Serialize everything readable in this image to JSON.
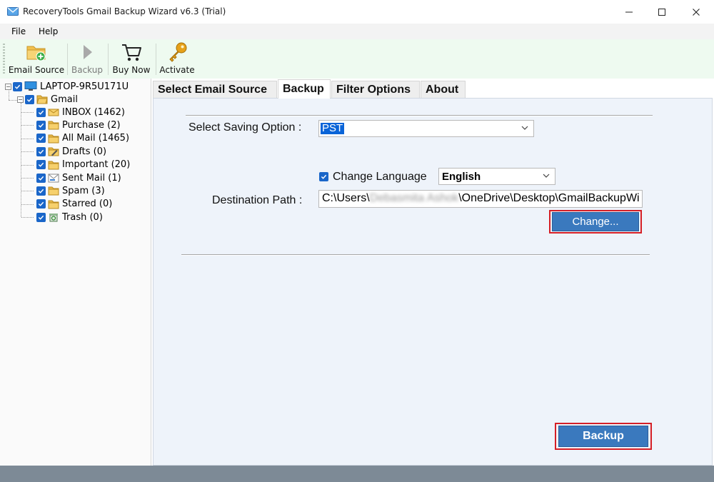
{
  "window": {
    "title": "RecoveryTools Gmail Backup Wizard v6.3 (Trial)",
    "minimize_glyph": "—",
    "maximize_glyph": "☐",
    "close_glyph": "✕"
  },
  "menu": {
    "items": [
      {
        "label": "File"
      },
      {
        "label": "Help"
      }
    ]
  },
  "toolbar": {
    "buttons": [
      {
        "label": "Email Source",
        "icon": "folder-add-icon",
        "enabled": true
      },
      {
        "label": "Backup",
        "icon": "play-icon",
        "enabled": false
      },
      {
        "label": "Buy Now",
        "icon": "cart-icon",
        "enabled": true
      },
      {
        "label": "Activate",
        "icon": "key-icon",
        "enabled": true
      }
    ]
  },
  "tree": {
    "root": {
      "label": "LAPTOP-9R5U171U",
      "expander": "−"
    },
    "account": {
      "label": "Gmail",
      "expander": "−"
    },
    "folders": [
      {
        "label": "INBOX (1462)",
        "icon": "inbox-icon"
      },
      {
        "label": "Purchase (2)",
        "icon": "folder-icon"
      },
      {
        "label": "All Mail (1465)",
        "icon": "folder-icon"
      },
      {
        "label": "Drafts (0)",
        "icon": "drafts-icon"
      },
      {
        "label": "Important (20)",
        "icon": "folder-icon"
      },
      {
        "label": "Sent Mail (1)",
        "icon": "sent-icon"
      },
      {
        "label": "Spam (3)",
        "icon": "folder-icon"
      },
      {
        "label": "Starred (0)",
        "icon": "folder-icon"
      },
      {
        "label": "Trash (0)",
        "icon": "trash-icon"
      }
    ]
  },
  "tabs": [
    {
      "label": "Select Email Source",
      "active": false
    },
    {
      "label": "Backup",
      "active": true
    },
    {
      "label": "Filter Options",
      "active": false
    },
    {
      "label": "About",
      "active": false
    }
  ],
  "backup": {
    "saving_option_label": "Select Saving Option :",
    "saving_option_value": "PST",
    "change_language_label": "Change Language",
    "change_language_checked": true,
    "language_value": "English",
    "destination_label": "Destination Path :",
    "destination_prefix": "C:\\Users\\",
    "destination_user": "Debasmita Ashok",
    "destination_suffix": "\\OneDrive\\Desktop\\GmailBackupWi",
    "change_button": "Change...",
    "backup_button": "Backup"
  },
  "colors": {
    "accent_button": "#3a79be",
    "highlight_outline": "#d51f26",
    "checkbox": "#1a66c9",
    "toolbar_bg": "#eefaf0",
    "panel_bg": "#eef3fa",
    "statusbar": "#7d8a96"
  }
}
